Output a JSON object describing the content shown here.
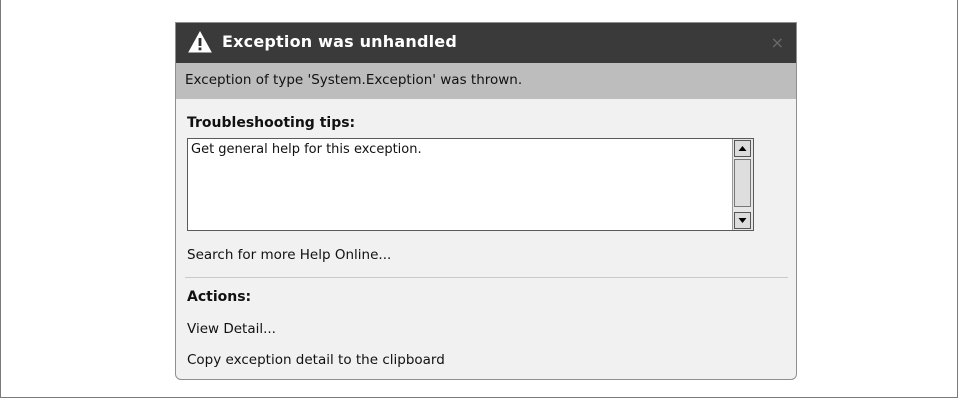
{
  "dialog": {
    "title": "Exception was unhandled",
    "close_glyph": "×",
    "message": "Exception of type 'System.Exception' was thrown.",
    "troubleshooting": {
      "heading": "Troubleshooting tips:",
      "tip": "Get general help for this exception."
    },
    "search_link": "Search for more Help Online...",
    "actions": {
      "heading": "Actions:",
      "items": [
        "View Detail...",
        "Copy exception detail to the clipboard"
      ]
    },
    "icons": {
      "title": "warning-icon",
      "close": "close-icon",
      "scroll_up": "arrow-up-icon",
      "scroll_down": "arrow-down-icon"
    },
    "colors": {
      "title_bar": "#3a3a3a",
      "message_band": "#bdbdbd",
      "body": "#f1f1f1"
    }
  }
}
